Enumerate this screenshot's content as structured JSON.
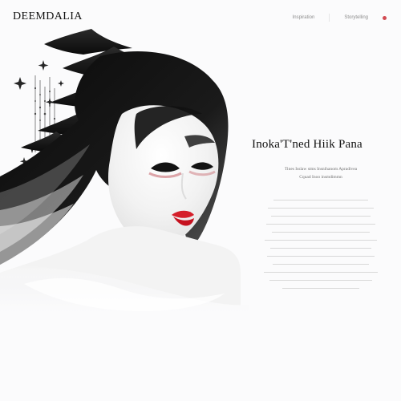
{
  "brand": {
    "logo_text": "DEEMDALIA"
  },
  "nav": {
    "items": [
      {
        "label": "Inspiration"
      },
      {
        "label": "Storytelling"
      }
    ],
    "status_dot_color": "#d24a52"
  },
  "hero": {
    "headline": "Inoka'T'ned Hiik Pana",
    "subheading_lines": [
      "Tines Isslaw stms Insnihanom Apradivea",
      "Cquad Inoo insmdimmn"
    ],
    "body_lines": [
      "",
      "",
      "",
      "",
      "",
      "",
      "",
      "",
      "",
      "",
      "",
      ""
    ]
  }
}
